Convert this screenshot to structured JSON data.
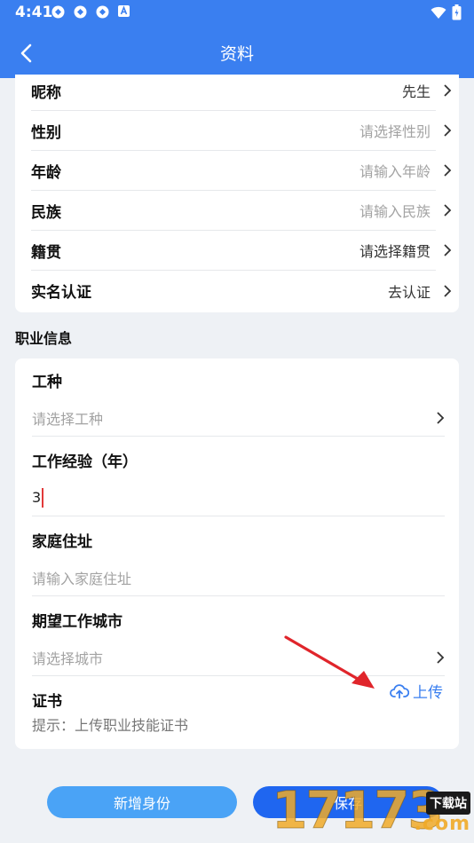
{
  "status_bar": {
    "time": "4:41"
  },
  "header": {
    "title": "资料"
  },
  "basic_rows": [
    {
      "label": "昵称",
      "value": "先生",
      "placeholder": false
    },
    {
      "label": "性别",
      "value": "请选择性别",
      "placeholder": true
    },
    {
      "label": "年龄",
      "value": "请输入年龄",
      "placeholder": true
    },
    {
      "label": "民族",
      "value": "请输入民族",
      "placeholder": true
    },
    {
      "label": "籍贯",
      "value": "请选择籍贯",
      "placeholder": false
    },
    {
      "label": "实名认证",
      "value": "去认证",
      "placeholder": false
    }
  ],
  "career": {
    "section_title": "职业信息",
    "job_type": {
      "label": "工种",
      "placeholder": "请选择工种"
    },
    "experience": {
      "label": "工作经验（年）",
      "value": "3"
    },
    "address": {
      "label": "家庭住址",
      "placeholder": "请输入家庭住址"
    },
    "city": {
      "label": "期望工作城市",
      "placeholder": "请选择城市"
    },
    "certificate": {
      "label": "证书",
      "upload_label": "上传",
      "hint": "提示：上传职业技能证书"
    }
  },
  "buttons": {
    "new_identity": "新增身份",
    "save": "保存"
  },
  "watermark": {
    "number": "17173",
    "tag": "下载站",
    "domain": ".com"
  },
  "colors": {
    "primary": "#3a7ff0",
    "button_light": "#4aa3f6",
    "button_dark": "#1f66f0",
    "arrow": "#e0252b"
  }
}
